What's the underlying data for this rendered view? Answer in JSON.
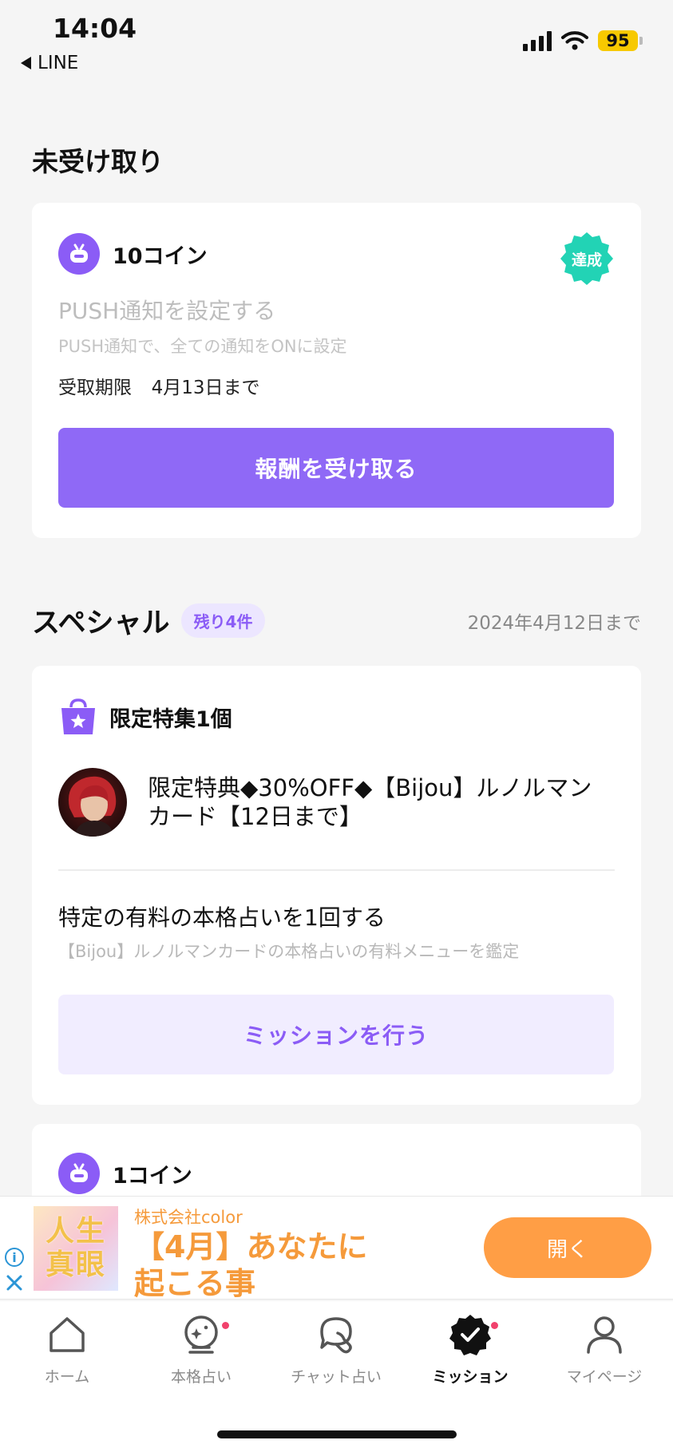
{
  "status_bar": {
    "time": "14:04",
    "back_app": "LINE",
    "battery": "95"
  },
  "unclaimed": {
    "section_title": "未受け取り",
    "reward_label": "10コイン",
    "achieved_badge": "達成",
    "task_title": "PUSH通知を設定する",
    "task_description": "PUSH通知で、全ての通知をONに設定",
    "expiry_label": "受取期限",
    "expiry_date": "4月13日まで",
    "claim_button": "報酬を受け取る"
  },
  "special": {
    "section_title": "スペシャル",
    "remaining_badge": "残り4件",
    "deadline": "2024年4月12日まで",
    "card": {
      "reward_label": "限定特集1個",
      "product_title": "限定特典◆30%OFF◆【Bijou】ルノルマンカード【12日まで】",
      "mission_title": "特定の有料の本格占いを1回する",
      "mission_description": "【Bijou】ルノルマンカードの本格占いの有料メニューを鑑定",
      "mission_button": "ミッションを行う"
    },
    "next_card": {
      "reward_label": "1コイン"
    }
  },
  "ad": {
    "image_text": "人生真眼",
    "company": "株式会社color",
    "headline": "【4月】あなたに起こる事",
    "open_button": "開く"
  },
  "tabs": [
    {
      "label": "ホーム",
      "icon": "home-icon"
    },
    {
      "label": "本格占い",
      "icon": "crystal-ball-icon"
    },
    {
      "label": "チャット占い",
      "icon": "chat-icon"
    },
    {
      "label": "ミッション",
      "icon": "mission-check-icon"
    },
    {
      "label": "マイページ",
      "icon": "person-icon"
    }
  ],
  "colors": {
    "accent": "#8f69f6",
    "achieved": "#22d3b5",
    "ad_orange": "#ff9e45",
    "notify_dot": "#f1416c"
  }
}
